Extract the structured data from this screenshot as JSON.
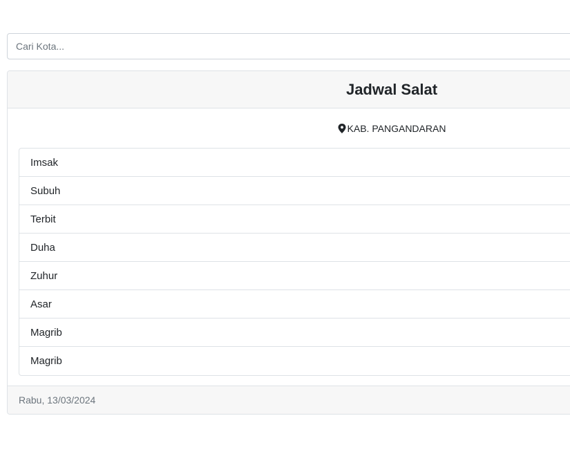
{
  "search": {
    "placeholder": "Cari Kota...",
    "value": ""
  },
  "card": {
    "title": "Jadwal Salat",
    "location_icon": "map-marker-icon",
    "location": "KAB. PANGANDARAN",
    "prayers": [
      {
        "label": "Imsak"
      },
      {
        "label": "Subuh"
      },
      {
        "label": "Terbit"
      },
      {
        "label": "Duha"
      },
      {
        "label": "Zuhur"
      },
      {
        "label": "Asar"
      },
      {
        "label": "Magrib"
      },
      {
        "label": "Magrib"
      }
    ],
    "footer_date": "Rabu, 13/03/2024"
  }
}
